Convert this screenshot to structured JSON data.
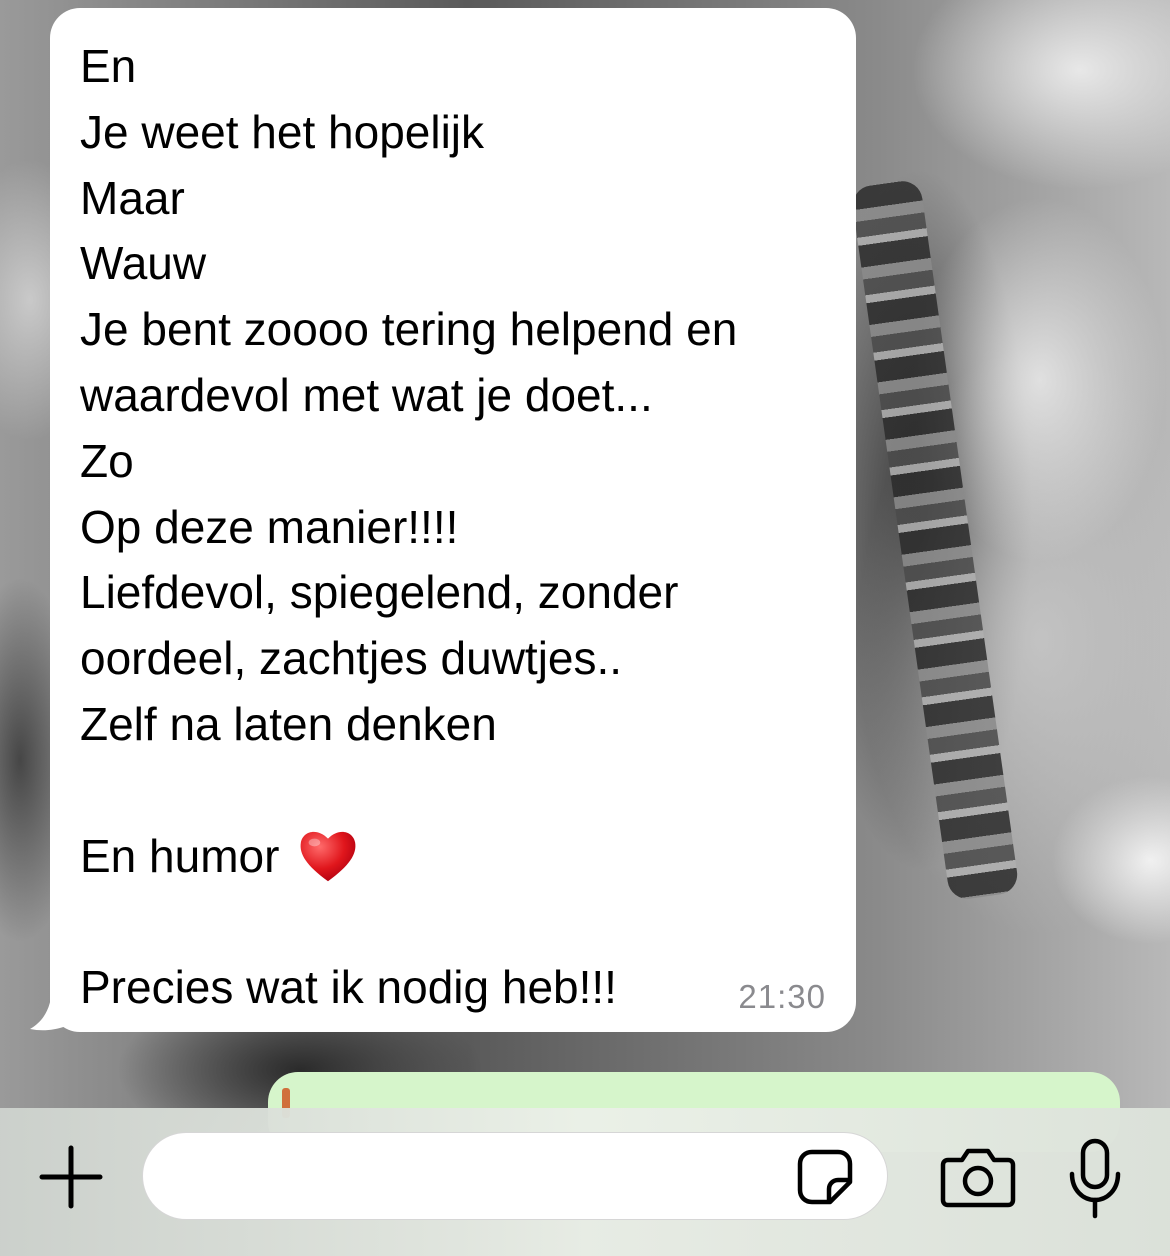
{
  "conversation": {
    "incoming_message": {
      "lines": [
        "En",
        "Je weet het hopelijk",
        "Maar",
        "Wauw",
        "Je bent zoooo tering helpend en",
        "waardevol met wat je doet...",
        "Zo",
        "Op deze manier!!!!",
        "Liefdevol, spiegelend, zonder",
        "oordeel, zachtjes duwtjes..",
        "Zelf na laten denken",
        "",
        "En humor",
        "",
        "Precies wat ik nodig heb!!!"
      ],
      "emoji": "red-heart",
      "time": "21:30",
      "bubble_color": "#ffffff"
    },
    "outgoing_bubble_color": "#d6f5cb",
    "quote_bar_color": "#d0703c"
  },
  "input_bar": {
    "message_value": "",
    "icons": {
      "attach": "plus-icon",
      "sticker": "sticker-icon",
      "camera": "camera-icon",
      "microphone": "microphone-icon"
    }
  }
}
